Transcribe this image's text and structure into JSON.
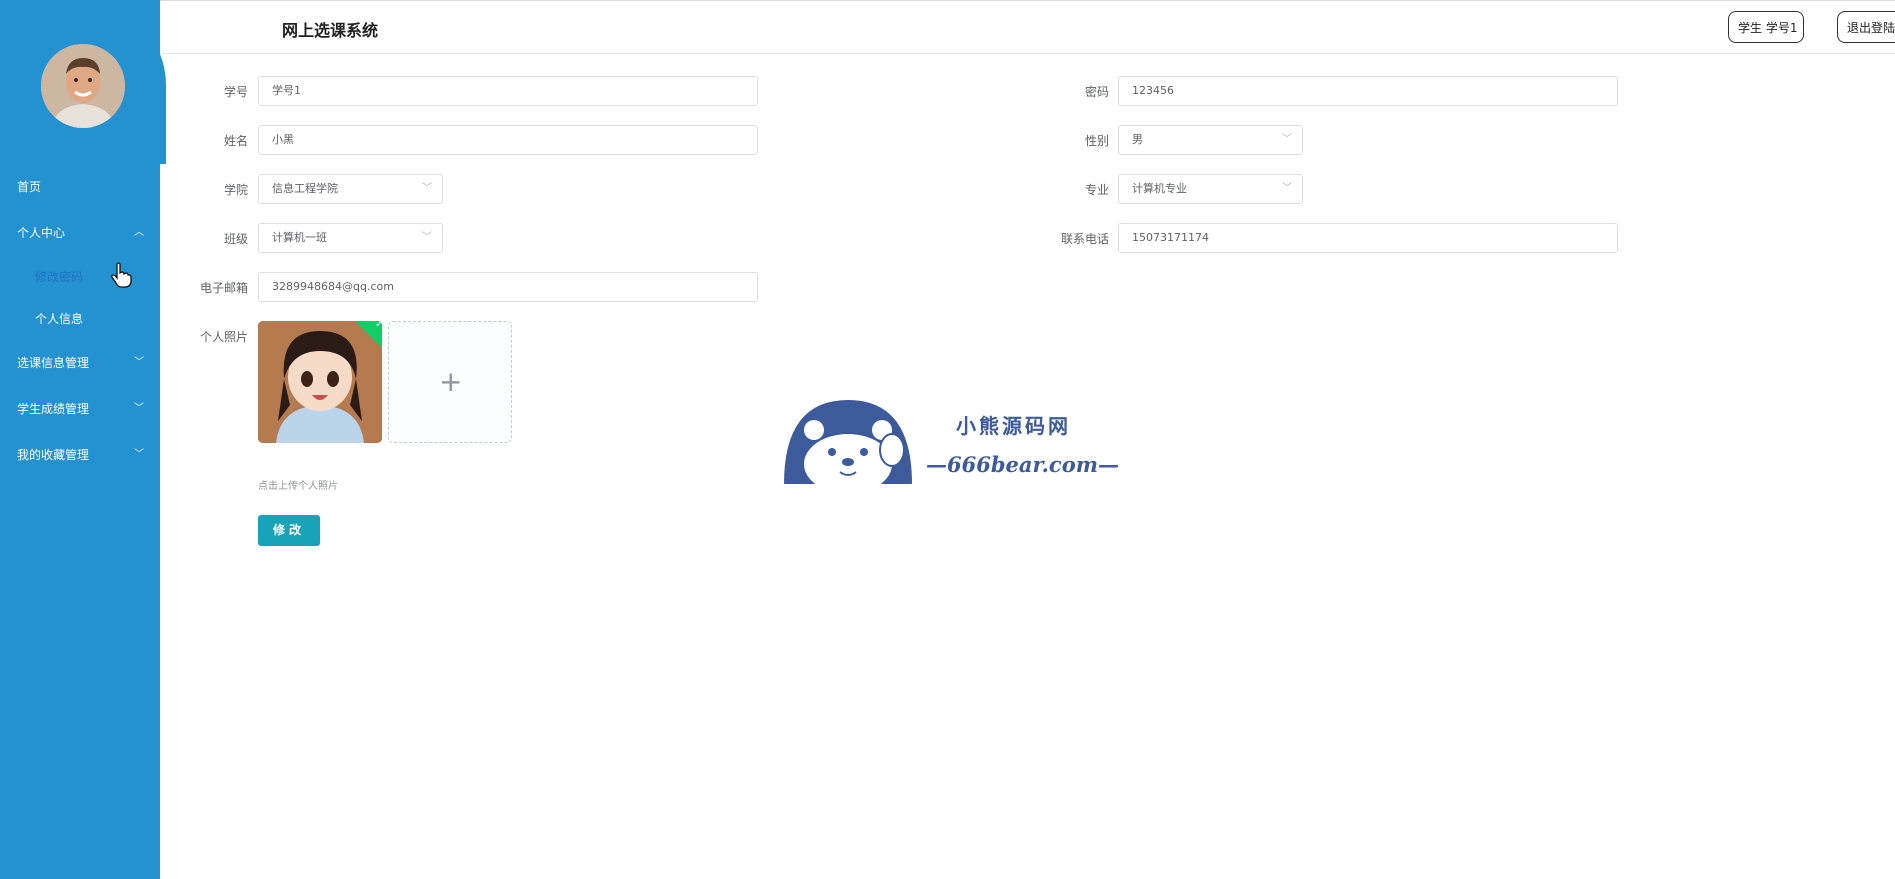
{
  "header": {
    "title": "网上选课系统",
    "user_label": "学生 学号1",
    "logout_label": "退出登陆"
  },
  "sidebar": {
    "items": [
      {
        "label": "首页"
      },
      {
        "label": "个人中心",
        "expanded": true
      },
      {
        "label": "选课信息管理"
      },
      {
        "label": "学生成绩管理"
      },
      {
        "label": "我的收藏管理"
      }
    ],
    "sub_items": [
      {
        "label": "修改密码",
        "active": true
      },
      {
        "label": "个人信息"
      }
    ]
  },
  "form": {
    "student_id": {
      "label": "学号",
      "value": "学号1"
    },
    "password": {
      "label": "密码",
      "value": "123456"
    },
    "name": {
      "label": "姓名",
      "value": "小黑"
    },
    "gender": {
      "label": "性别",
      "value": "男"
    },
    "college": {
      "label": "学院",
      "value": "信息工程学院"
    },
    "major": {
      "label": "专业",
      "value": "计算机专业"
    },
    "class": {
      "label": "班级",
      "value": "计算机一班"
    },
    "phone": {
      "label": "联系电话",
      "value": "15073171174"
    },
    "email": {
      "label": "电子邮箱",
      "value": "3289948684@qq.com"
    },
    "photo": {
      "label": "个人照片",
      "upload_tip": "点击上传个人照片"
    },
    "submit_label": "修改"
  },
  "watermark": {
    "cn": "小熊源码网",
    "en": "—666bear.com—"
  },
  "colors": {
    "sidebar": "#2491d1",
    "accent_button": "#17a3b8",
    "active_sub_item": "#1e74c2",
    "upload_check": "#13ce66",
    "watermark": "#3d5a9a"
  }
}
